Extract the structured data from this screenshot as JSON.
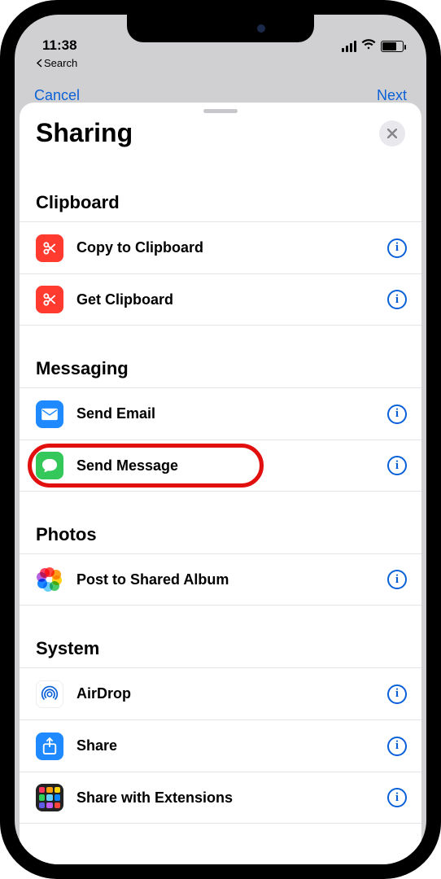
{
  "status": {
    "time": "11:38",
    "breadcrumb": "Search"
  },
  "navBehind": {
    "left": "Cancel",
    "right": "Next"
  },
  "sheet": {
    "title": "Sharing"
  },
  "sections": {
    "clipboard": {
      "header": "Clipboard",
      "items": [
        {
          "label": "Copy to Clipboard"
        },
        {
          "label": "Get Clipboard"
        }
      ]
    },
    "messaging": {
      "header": "Messaging",
      "items": [
        {
          "label": "Send Email"
        },
        {
          "label": "Send Message"
        }
      ]
    },
    "photos": {
      "header": "Photos",
      "items": [
        {
          "label": "Post to Shared Album"
        }
      ]
    },
    "system": {
      "header": "System",
      "items": [
        {
          "label": "AirDrop"
        },
        {
          "label": "Share"
        },
        {
          "label": "Share with Extensions"
        }
      ]
    }
  }
}
